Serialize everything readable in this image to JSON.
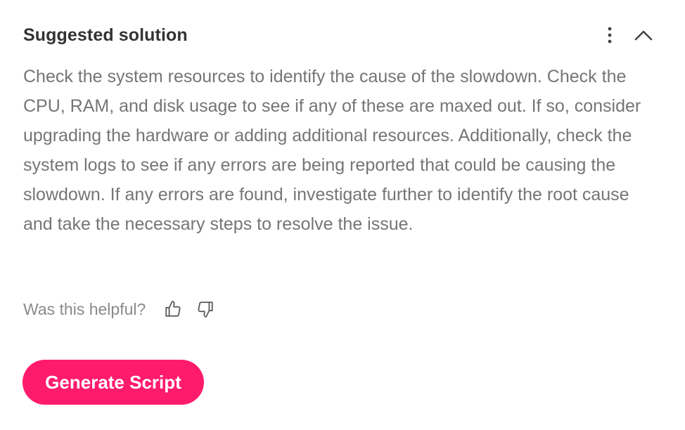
{
  "card": {
    "title": "Suggested solution",
    "body": "Check the system resources to identify the cause of the slowdown. Check the CPU, RAM, and disk usage to see if any of these are maxed out. If so, consider upgrading the hardware or adding additional resources. Additionally, check the system logs to see if any errors are being reported that could be causing the slowdown. If any errors are found, investigate further to identify the root cause and take the necessary steps to resolve the issue.",
    "icons": {
      "more": "more-vertical-icon",
      "collapse": "chevron-up-icon",
      "thumbs_up": "thumbs-up-icon",
      "thumbs_down": "thumbs-down-icon"
    }
  },
  "feedback": {
    "label": "Was this helpful?"
  },
  "actions": {
    "generate_label": "Generate Script"
  },
  "colors": {
    "accent": "#ff1b6b",
    "title": "#333333",
    "body": "#757575",
    "muted": "#8a8a8a"
  }
}
